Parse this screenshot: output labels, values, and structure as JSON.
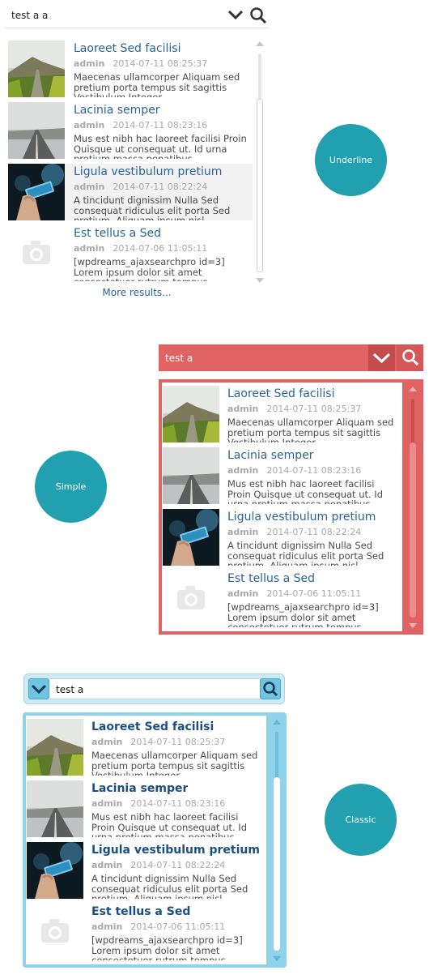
{
  "labels": {
    "underline": "Underline",
    "simple": "Simple",
    "classic": "Classic"
  },
  "colors": {
    "teal": "#22a0b0",
    "simple_red": "#e06262",
    "classic_blue": "#8fd2ea",
    "link_blue": "#2a6496"
  },
  "results": [
    {
      "title": "Laoreet Sed facilisi",
      "author": "admin",
      "date": "2014-07-11 08:25:37",
      "desc": "Maecenas ullamcorper Aliquam sed pretium porta tempus sit sagittis Vestibulum Integer",
      "image": "mountain-road"
    },
    {
      "title": "Lacinia semper",
      "author": "admin",
      "date": "2014-07-11 08:23:16",
      "desc": "Mus est nibh hac laoreet facilisi Proin Quisque ut consequat ut. Id urna pretium massa penatibus",
      "image": "empty-road"
    },
    {
      "title": "Ligula vestibulum pretium",
      "author": "admin",
      "date": "2014-07-11 08:22:24",
      "desc": "A tincidunt dignissim Nulla Sed consequat ridiculus elit porta Sed pretium. Aliquam ipsum nisl",
      "image": "hand-phone"
    },
    {
      "title": "Est tellus a Sed",
      "author": "admin",
      "date": "2014-07-06 11:05:11",
      "desc": "[wpdreams_ajaxsearchpro id=3] Lorem ipsum dolor sit amet consectetuer rutrum tempus",
      "image": "placeholder-camera"
    }
  ],
  "underline": {
    "query": "test a a",
    "more_results": "More results..."
  },
  "simple": {
    "query": "test a"
  },
  "classic": {
    "query": "test a"
  }
}
